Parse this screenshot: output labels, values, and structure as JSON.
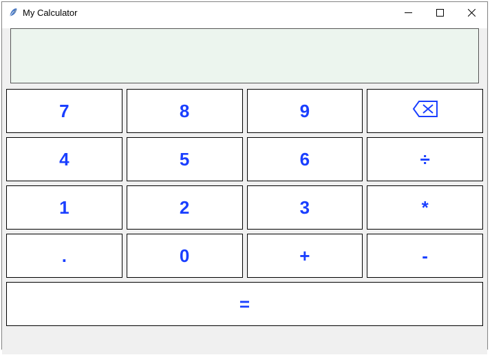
{
  "window": {
    "title": "My Calculator"
  },
  "display": {
    "value": ""
  },
  "keys": {
    "row1": {
      "k1": "7",
      "k2": "8",
      "k3": "9"
    },
    "row2": {
      "k1": "4",
      "k2": "5",
      "k3": "6",
      "k4": "÷"
    },
    "row3": {
      "k1": "1",
      "k2": "2",
      "k3": "3",
      "k4": "*"
    },
    "row4": {
      "k1": ".",
      "k2": "0",
      "k3": "+",
      "k4": "-"
    },
    "equals": "="
  }
}
